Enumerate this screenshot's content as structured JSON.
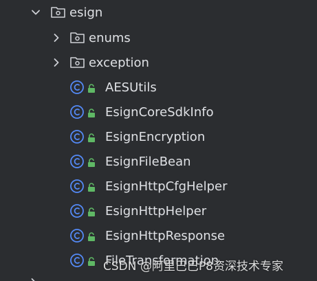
{
  "tree": {
    "root": {
      "label": "esign",
      "icon": "folder-package-icon",
      "expanded": true
    },
    "folders": [
      {
        "label": "enums",
        "icon": "folder-package-icon",
        "expanded": false
      },
      {
        "label": "exception",
        "icon": "folder-package-icon",
        "expanded": false
      }
    ],
    "classes": [
      {
        "label": "AESUtils"
      },
      {
        "label": "EsignCoreSdkInfo"
      },
      {
        "label": "EsignEncryption"
      },
      {
        "label": "EsignFileBean"
      },
      {
        "label": "EsignHttpCfgHelper"
      },
      {
        "label": "EsignHttpHelper"
      },
      {
        "label": "EsignHttpResponse"
      },
      {
        "label": "FileTransformation"
      }
    ]
  },
  "watermark": "CSDN @阿里巴巴P8资深技术专家",
  "colors": {
    "background": "#2b2d30",
    "text": "#dfe1e5",
    "class_icon": "#548af7",
    "lock_icon": "#5fb865",
    "chevron": "#cfd1d6"
  }
}
